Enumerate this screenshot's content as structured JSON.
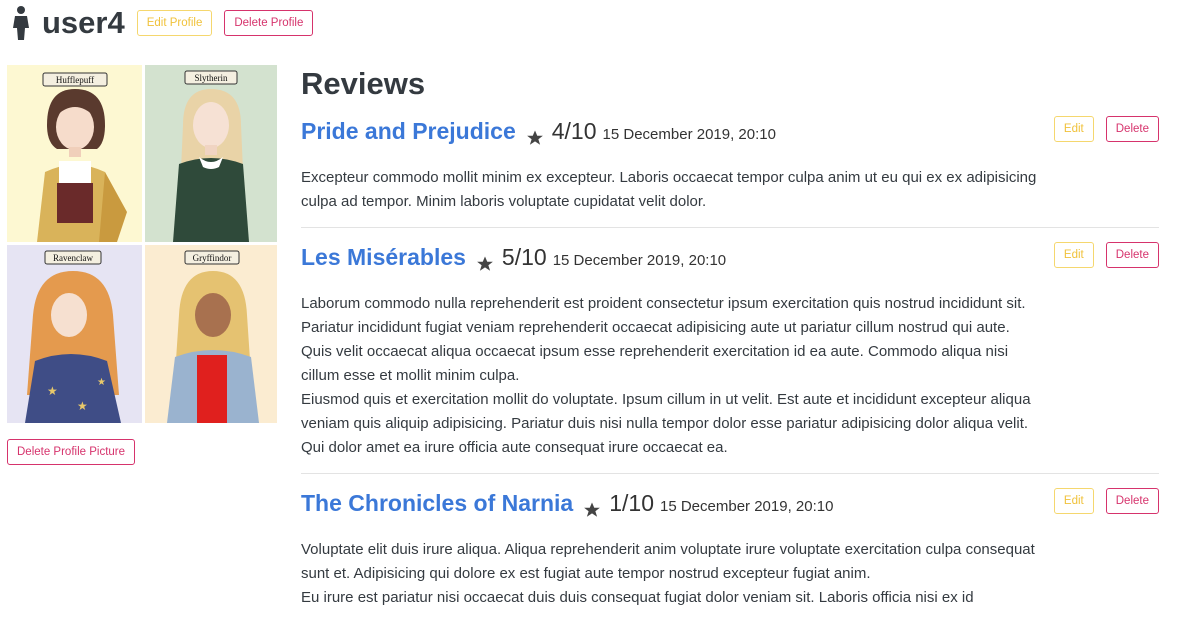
{
  "header": {
    "username": "user4",
    "edit_profile_label": "Edit Profile",
    "delete_profile_label": "Delete Profile"
  },
  "profile": {
    "delete_picture_label": "Delete Profile Picture",
    "house_banners": [
      "Hufflepuff",
      "Slytherin",
      "Ravenclaw",
      "Gryffindor"
    ]
  },
  "reviews": {
    "title": "Reviews",
    "edit_label": "Edit",
    "delete_label": "Delete",
    "items": [
      {
        "book_title": "Pride and Prejudice",
        "rating": "4/10",
        "date": "15 December 2019, 20:10",
        "paragraphs": [
          "Excepteur commodo mollit minim ex excepteur. Laboris occaecat tempor culpa anim ut eu qui ex ex adipisicing culpa ad tempor. Minim laboris voluptate cupidatat velit dolor."
        ]
      },
      {
        "book_title": "Les Misérables",
        "rating": "5/10",
        "date": "15 December 2019, 20:10",
        "paragraphs": [
          "Laborum commodo nulla reprehenderit est proident consectetur ipsum exercitation quis nostrud incididunt sit. Pariatur incididunt fugiat veniam reprehenderit occaecat adipisicing aute ut pariatur cillum nostrud qui aute. Quis velit occaecat aliqua occaecat ipsum esse reprehenderit exercitation id ea aute. Commodo aliqua nisi cillum esse et mollit minim culpa.",
          "Eiusmod quis et exercitation mollit do voluptate. Ipsum cillum in ut velit. Est aute et incididunt excepteur aliqua veniam quis aliquip adipisicing. Pariatur duis nisi nulla tempor dolor esse pariatur adipisicing dolor aliqua velit. Qui dolor amet ea irure officia aute consequat irure occaecat ea."
        ]
      },
      {
        "book_title": "The Chronicles of Narnia",
        "rating": "1/10",
        "date": "15 December 2019, 20:10",
        "paragraphs": [
          "Voluptate elit duis irure aliqua. Aliqua reprehenderit anim voluptate irure voluptate exercitation culpa consequat sunt et. Adipisicing qui dolore ex est fugiat aute tempor nostrud excepteur fugiat anim.",
          "Eu irure est pariatur nisi occaecat duis duis consequat fugiat dolor veniam sit. Laboris officia nisi ex id"
        ]
      }
    ]
  },
  "colors": {
    "link": "#3b78d8",
    "warning": "#f0c23b",
    "danger": "#d6336c"
  },
  "icons": {
    "user": "person-icon",
    "rating": "star-icon"
  }
}
